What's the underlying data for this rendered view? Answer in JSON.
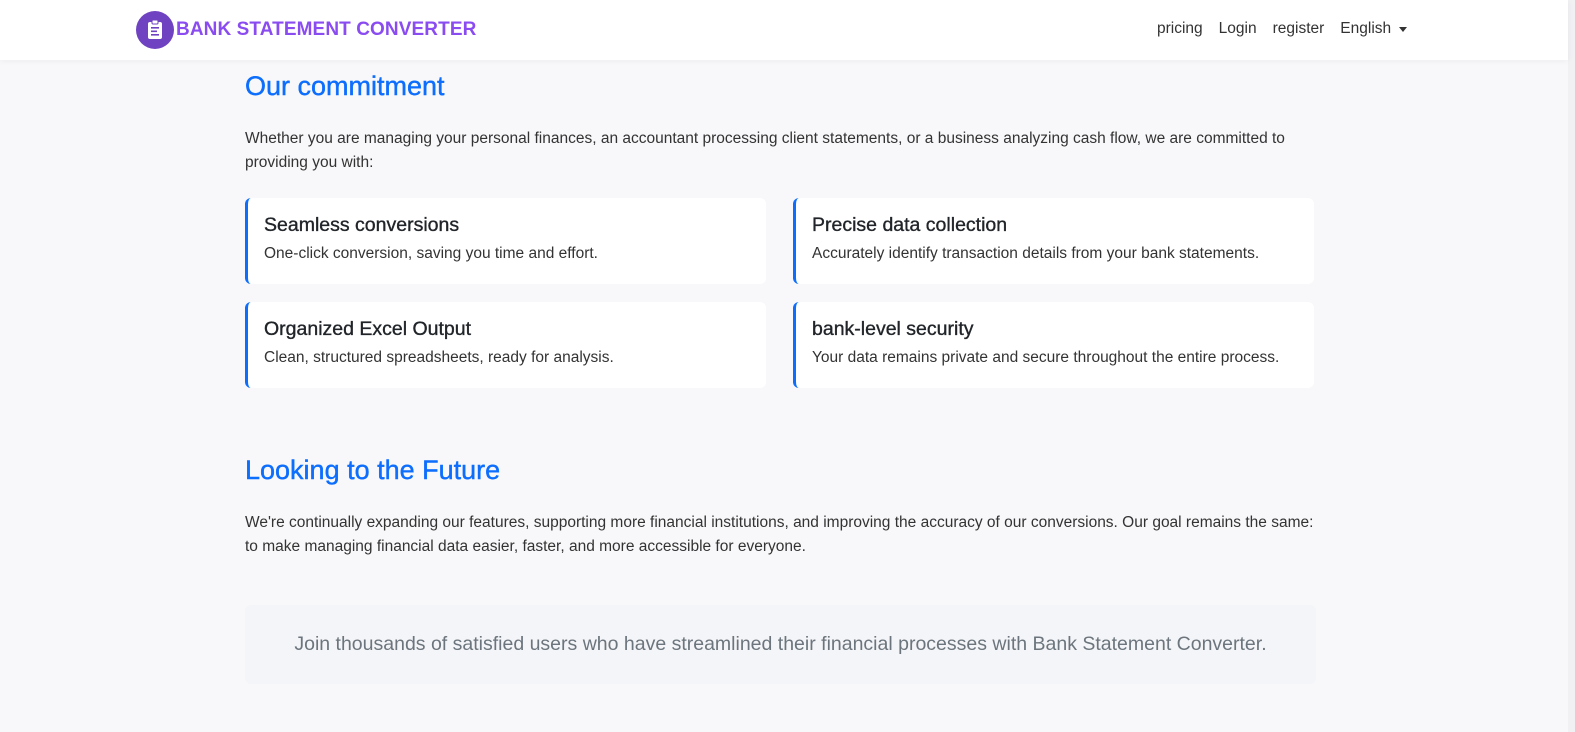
{
  "navbar": {
    "brand": "BANK STATEMENT CONVERTER",
    "brand_icon": "document-clipboard-icon",
    "links": {
      "pricing": "pricing",
      "login": "Login",
      "register": "register",
      "language": "English"
    }
  },
  "commitment": {
    "title": "Our commitment",
    "intro": "Whether you are managing your personal finances, an accountant processing client statements, or a business analyzing cash flow, we are committed to providing you with:",
    "cards": [
      {
        "title": "Seamless conversions",
        "text": "One-click conversion, saving you time and effort."
      },
      {
        "title": "Precise data collection",
        "text": "Accurately identify transaction details from your bank statements."
      },
      {
        "title": "Organized Excel Output",
        "text": "Clean, structured spreadsheets, ready for analysis."
      },
      {
        "title": "bank-level security",
        "text": "Your data remains private and secure throughout the entire process."
      }
    ]
  },
  "future": {
    "title": "Looking to the Future",
    "text": "We're continually expanding our features, supporting more financial institutions, and improving the accuracy of our conversions. Our goal remains the same: to make managing financial data easier, faster, and more accessible for everyone."
  },
  "cta": {
    "text": "Join thousands of satisfied users who have streamlined their financial processes with Bank Statement Converter."
  },
  "colors": {
    "accent": "#0d6efd",
    "brand": "#8a4cf0",
    "logo_bg": "#6f42c1"
  }
}
